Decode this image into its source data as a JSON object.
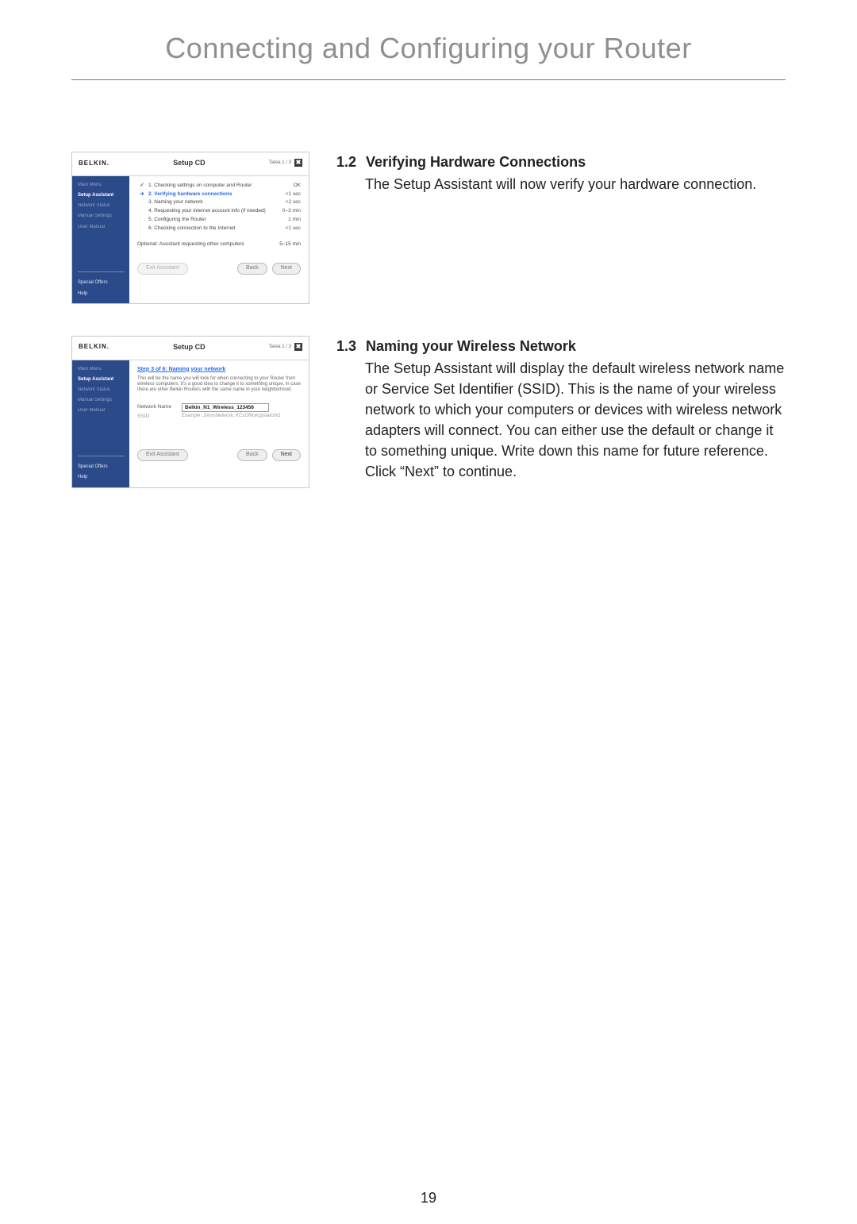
{
  "page": {
    "title": "Connecting and Configuring your Router",
    "number": "19"
  },
  "sections": [
    {
      "num": "1.2",
      "title": "Verifying Hardware Connections",
      "body": "The Setup Assistant will now verify your hardware connection."
    },
    {
      "num": "1.3",
      "title": "Naming your Wireless Network",
      "body": "The Setup Assistant will display the default wireless network name or Service Set Identifier (SSID). This is the name of your wireless network to which your computers or devices with wireless network adapters will connect. You can either use the default or change it to something unique. Write down this name for future reference. Click “Next” to continue."
    }
  ],
  "shot_common": {
    "brand": "BELKIN.",
    "window_title": "Setup CD",
    "tarea_label": "Tarea 1 / 3",
    "close_glyph": "✖",
    "sidebar": {
      "items": [
        {
          "label": "Main Menu",
          "state": "muted"
        },
        {
          "label": "Setup Assistant",
          "state": "active"
        },
        {
          "label": "Network Status",
          "state": "muted"
        },
        {
          "label": "Manual Settings",
          "state": "muted"
        },
        {
          "label": "User Manual",
          "state": "muted"
        }
      ],
      "bottom": [
        {
          "label": "Special Offers"
        },
        {
          "label": "Help"
        }
      ]
    },
    "buttons": {
      "exit": "Exit Assistant",
      "back": "Back",
      "next": "Next"
    }
  },
  "shot1": {
    "steps_title": "",
    "steps": [
      {
        "icon": "done",
        "label": "1. Checking settings on computer and Router",
        "time": "OK"
      },
      {
        "icon": "arrow",
        "label": "2. Verifying hardware connections",
        "time": "<1 sec",
        "active": true
      },
      {
        "icon": "",
        "label": "3. Naming your network",
        "time": "<2 sec"
      },
      {
        "icon": "",
        "label": "4. Requesting your internet account info (if needed)",
        "time": "0–3 min"
      },
      {
        "icon": "",
        "label": "5. Configuring the Router",
        "time": "1 min"
      },
      {
        "icon": "",
        "label": "6. Checking connection to the Internet",
        "time": "<1 sec"
      }
    ],
    "optional": {
      "label": "Optional: Assistant requesting other computers",
      "time": "5–15 min"
    }
  },
  "shot2": {
    "heading": "Step 3 of 6: Naming your network",
    "description": "This will be the name you will look for when connecting to your Router from wireless computers. It's a good idea to change it to something unique, in case there are other Belkin Routers with the same name in your neighborhood.",
    "field_label": "Network Name",
    "ssid_label_secondary": "SSID",
    "ssid_value": "Belkin_N1_Wireless_123456",
    "example_hint": "Example: JohnsNetwork, KCsOfficeUpstairsN1"
  }
}
